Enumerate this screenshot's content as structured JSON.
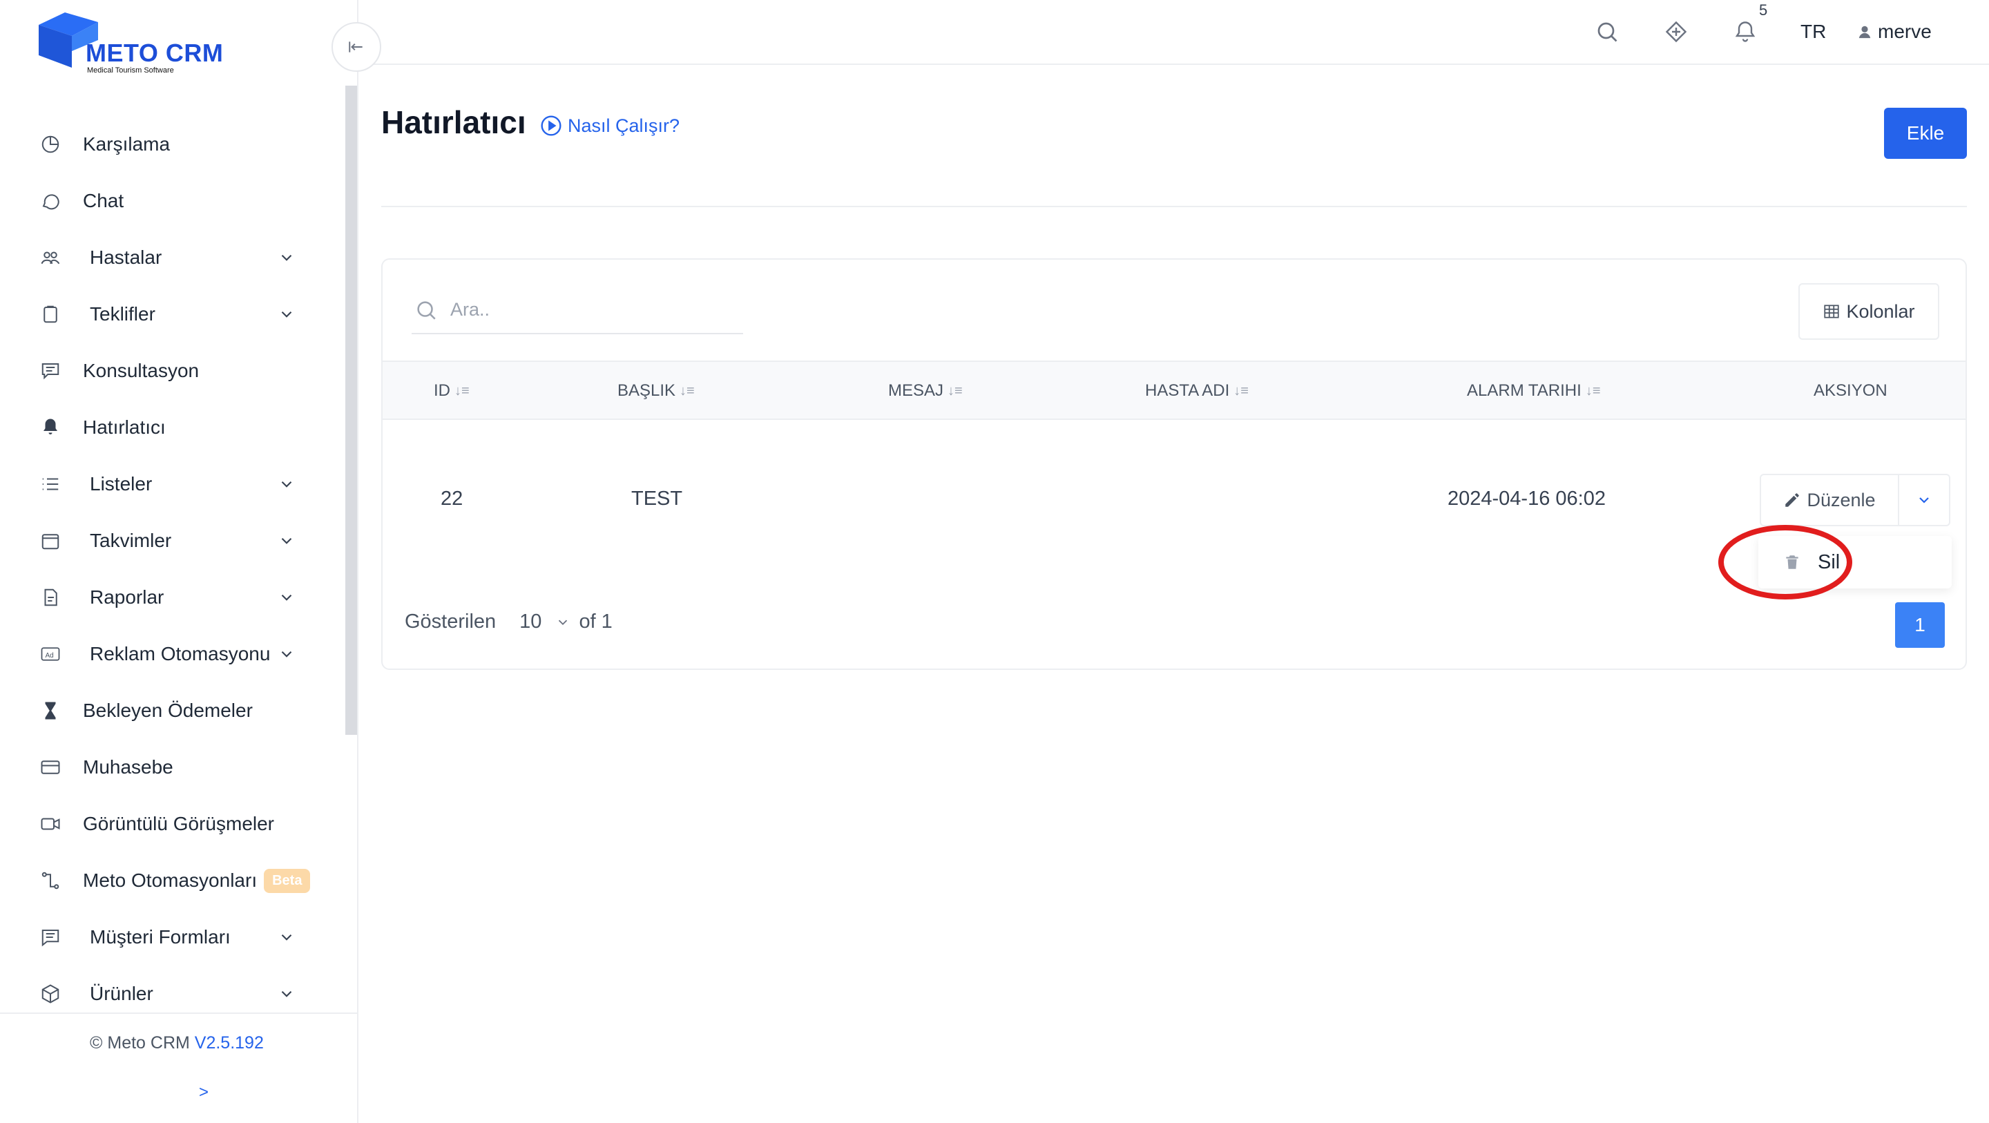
{
  "brand": {
    "title": "METO CRM",
    "subtitle": "Medical Tourism Software"
  },
  "sidebar": {
    "items": [
      {
        "label": "Karşılama",
        "icon": "dashboard-icon",
        "submenu": false
      },
      {
        "label": "Chat",
        "icon": "chat-icon",
        "submenu": false
      },
      {
        "label": "Hastalar",
        "icon": "users-icon",
        "submenu": true
      },
      {
        "label": "Teklifler",
        "icon": "clipboard-icon",
        "submenu": true
      },
      {
        "label": "Konsultasyon",
        "icon": "message-icon",
        "submenu": false
      },
      {
        "label": "Hatırlatıcı",
        "icon": "bell-icon",
        "submenu": false,
        "active": true
      },
      {
        "label": "Listeler",
        "icon": "list-icon",
        "submenu": true
      },
      {
        "label": "Takvimler",
        "icon": "calendar-icon",
        "submenu": true
      },
      {
        "label": "Raporlar",
        "icon": "report-icon",
        "submenu": true
      },
      {
        "label": "Reklam Otomasyonu",
        "icon": "ad-icon",
        "submenu": true
      },
      {
        "label": "Bekleyen Ödemeler",
        "icon": "hourglass-icon",
        "submenu": false
      },
      {
        "label": "Muhasebe",
        "icon": "card-icon",
        "submenu": false
      },
      {
        "label": "Görüntülü Görüşmeler",
        "icon": "video-icon",
        "submenu": false
      },
      {
        "label": "Meto Otomasyonları",
        "icon": "automation-icon",
        "submenu": false,
        "badge": "Beta"
      },
      {
        "label": "Müşteri Formları",
        "icon": "form-icon",
        "submenu": true
      },
      {
        "label": "Ürünler",
        "icon": "box-icon",
        "submenu": true
      }
    ],
    "footer": {
      "copyright": "© Meto CRM",
      "version": "V2.5.192",
      "expand": ">"
    }
  },
  "topbar": {
    "notification_count": "5",
    "language": "TR",
    "username": "merve"
  },
  "main": {
    "title": "Hatırlatıcı",
    "how_link": "Nasıl Çalışır?",
    "add_button": "Ekle",
    "search_placeholder": "Ara..",
    "columns_button": "Kolonlar",
    "table": {
      "headers": [
        "ID",
        "BAŞLIK",
        "MESAJ",
        "HASTA ADI",
        "ALARM TARIHI",
        "AKSIYON"
      ],
      "rows": [
        {
          "id": "22",
          "title": "TEST",
          "message": "",
          "patient": "",
          "alarm_date": "2024-04-16 06:02"
        }
      ]
    },
    "row_actions": {
      "edit": "Düzenle",
      "delete": "Sil"
    },
    "pagination": {
      "label": "Gösterilen",
      "page_size": "10",
      "of": "of 1",
      "current_page": "1"
    }
  },
  "colors": {
    "accent": "#2563eb",
    "highlight_circle": "#e11d1d",
    "beta_badge": "#fcd9a8"
  }
}
